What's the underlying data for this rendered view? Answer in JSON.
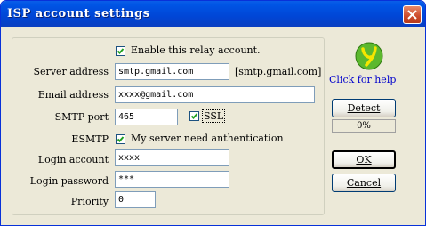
{
  "window": {
    "title": "ISP account settings"
  },
  "form": {
    "enable_relay_label": "Enable this relay account.",
    "enable_relay_checked": true,
    "server_address_label": "Server address",
    "server_address_value": "smtp.gmail.com",
    "server_address_hint": "[smtp.gmail.com]",
    "email_address_label": "Email address",
    "email_address_value": "xxxx@gmail.com",
    "smtp_port_label": "SMTP port",
    "smtp_port_value": "465",
    "ssl_label": "SSL",
    "ssl_checked": true,
    "esmtp_label": "ESMTP",
    "esmtp_checkbox_label": "My server need anthentication",
    "esmtp_checked": true,
    "login_account_label": "Login account",
    "login_account_value": "xxxx",
    "login_password_label": "Login password",
    "login_password_value": "***",
    "priority_label": "Priority",
    "priority_value": "0"
  },
  "side": {
    "help_label": "Click for help",
    "detect_label": "Detect",
    "detect_progress": "0%",
    "ok_label": "OK",
    "cancel_label": "Cancel"
  },
  "colors": {
    "titlebar": "#0054e3",
    "link": "#0000cc",
    "logo_green": "#5cb82e",
    "logo_yellow": "#f5e500"
  }
}
